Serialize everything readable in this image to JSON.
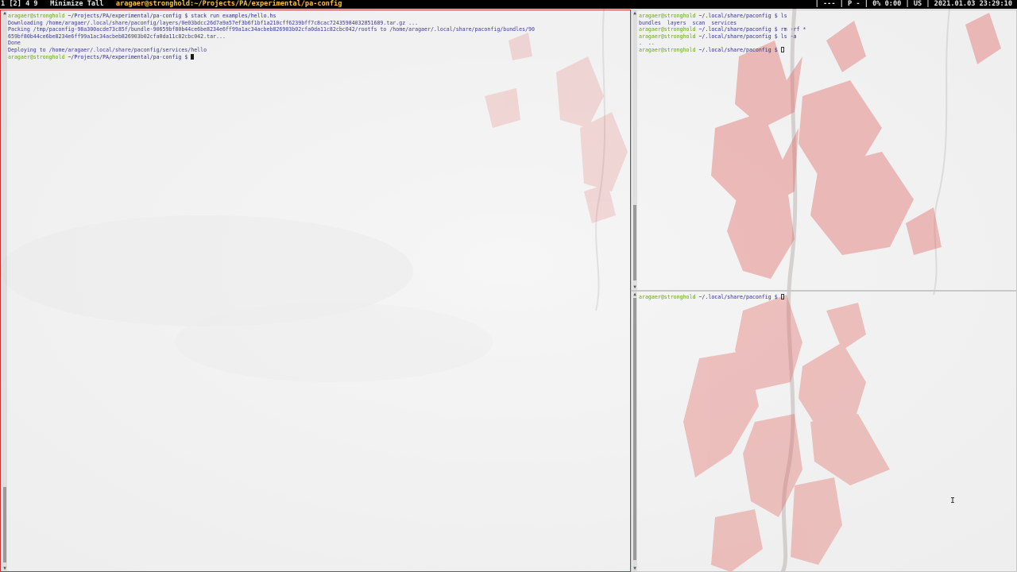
{
  "statusbar": {
    "workspaces_prefix": "1 ",
    "workspace_current": "[2]",
    "workspaces_rest": " 4 9",
    "layout": "Minimize Tall",
    "window_title": "aragaer@stronghold:~/Projects/PA/experimental/pa-config",
    "right_text": "| --- | P - | 0% 0:00 | US | 2021.01.03 23:29:10"
  },
  "terminals": {
    "main": {
      "lines": [
        {
          "user": "aragaer@stronghold",
          "path": " ~/Projects/PA/experimental/pa-config $ ",
          "cmd": "stack run examples/hello.hs"
        },
        {
          "out": "Downloading /home/aragaer/.local/share/paconfig/layers/0e03bdcc26d7a9a57ef3b6f1bf1a210cff6239bff7c8cac72435984032851689.tar.gz ..."
        },
        {
          "out": "Packing /tmp/paconfig-98a300acde73c85f/bundle-90659bf80b44ce6be8234e6ff99a1ac34acbeb826903b02cfa0da11c82cbc042/rootfs to /home/aragaer/.local/share/paconfig/bundles/90"
        },
        {
          "out": "659bf80b44ce6be8234e6ff99a1ac34acbeb826903b02cfa0da11c82cbc042.tar..."
        },
        {
          "out": "Done"
        },
        {
          "out": "Deploying to /home/aragaer/.local/share/paconfig/services/hello"
        },
        {
          "user": "aragaer@stronghold",
          "path": " ~/Projects/PA/experimental/pa-config $ ",
          "cmd": "",
          "cursor": "block"
        }
      ]
    },
    "top_right": {
      "lines": [
        {
          "user": "aragaer@stronghold",
          "path": " ~/.local/share/paconfig $ ",
          "cmd": "ls"
        },
        {
          "out": "bundles  layers  scan  services"
        },
        {
          "user": "aragaer@stronghold",
          "path": " ~/.local/share/paconfig $ ",
          "cmd": "rm -rf *"
        },
        {
          "user": "aragaer@stronghold",
          "path": " ~/.local/share/paconfig $ ",
          "cmd": "ls -a"
        },
        {
          "out": ".  .."
        },
        {
          "user": "aragaer@stronghold",
          "path": " ~/.local/share/paconfig $ ",
          "cmd": "",
          "cursor": "hollow"
        }
      ]
    },
    "bottom_right": {
      "lines": [
        {
          "user": "aragaer@stronghold",
          "path": " ~/.local/share/paconfig $ ",
          "cmd": "",
          "cursor": "hollow"
        }
      ]
    }
  },
  "colors": {
    "focused_border": "#c9343a",
    "unfocused_border": "#c8c8c8",
    "prompt_user": "#6aa220",
    "prompt_path": "#2c2c8a",
    "statusbar_title": "#f4c542",
    "leaf_red": "#d9322b"
  },
  "icons": {
    "mouse_cursor": "text-ibeam-icon",
    "scroll_up": "triangle-up-icon",
    "scroll_down": "triangle-down-icon"
  }
}
